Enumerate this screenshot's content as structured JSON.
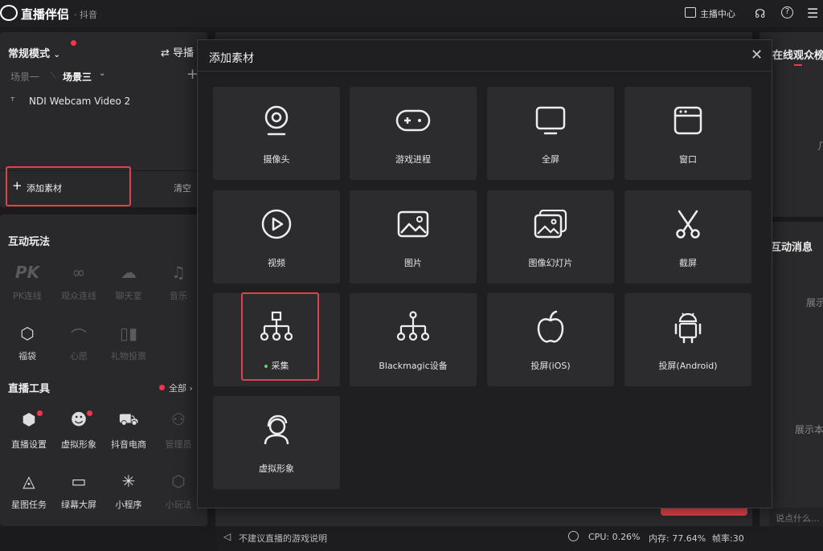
{
  "app": {
    "name": "直播伴侣",
    "sub": "· 抖音"
  },
  "titlebar": {
    "anchor_center": "主播中心"
  },
  "left": {
    "mode": "常规模式",
    "director": "导播",
    "scenes": [
      "场景一",
      "场景三"
    ],
    "source_item": "NDI Webcam Video 2",
    "add_material": "添加素材",
    "clear": "清空",
    "interactive_title": "互动玩法",
    "interactive_items": [
      "PK连线",
      "观众连线",
      "聊天室",
      "音乐",
      "福袋",
      "心愿",
      "礼物投票"
    ],
    "tools_title": "直播工具",
    "tools_all": "全部",
    "tools_items": [
      "直播设置",
      "虚拟形象",
      "抖音电商",
      "管理员",
      "星图任务",
      "绿幕大屏",
      "小程序",
      "小玩法"
    ]
  },
  "modal": {
    "title": "添加素材",
    "tiles": [
      {
        "label": "摄像头",
        "icon": "webcam-icon"
      },
      {
        "label": "游戏进程",
        "icon": "gamepad-icon"
      },
      {
        "label": "全屏",
        "icon": "monitor-icon"
      },
      {
        "label": "窗口",
        "icon": "window-icon"
      },
      {
        "label": "视频",
        "icon": "play-icon"
      },
      {
        "label": "图片",
        "icon": "image-icon"
      },
      {
        "label": "图像幻灯片",
        "icon": "slideshow-icon"
      },
      {
        "label": "截屏",
        "icon": "scissors-icon"
      },
      {
        "label": "采集",
        "icon": "capture-icon"
      },
      {
        "label": "Blackmagic设备",
        "icon": "blackmagic-icon"
      },
      {
        "label": "投屏(iOS)",
        "icon": "apple-icon"
      },
      {
        "label": "投屏(Android)",
        "icon": "android-icon"
      },
      {
        "label": "虚拟形象",
        "icon": "avatar-icon"
      }
    ]
  },
  "right": {
    "viewers": "在线观众榜",
    "messages": "互动消息",
    "show1": "展示",
    "show2": "展示本",
    "input_placeholder": "说点什么...",
    "partial_char": "几"
  },
  "status": {
    "tip": "不建议直播的游戏说明",
    "cpu": "CPU: 0.26%",
    "mem": "内存: 77.64%",
    "fps": "帧率:30"
  },
  "colors": {
    "accent": "#e0424a",
    "green_dot": "#62d26f"
  }
}
